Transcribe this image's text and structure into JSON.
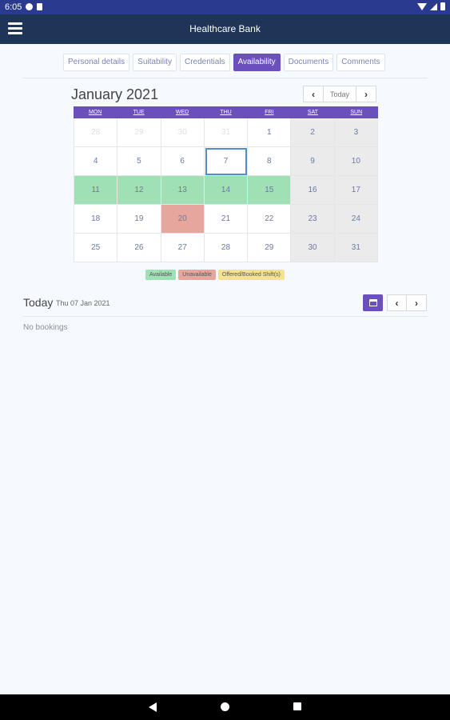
{
  "status_bar": {
    "time": "6:05"
  },
  "app_bar": {
    "title": "Healthcare Bank",
    "menu_icon": "hamburger-menu-icon"
  },
  "tabs": [
    {
      "label": "Personal details",
      "active": false
    },
    {
      "label": "Suitability",
      "active": false
    },
    {
      "label": "Credentials",
      "active": false
    },
    {
      "label": "Availability",
      "active": true
    },
    {
      "label": "Documents",
      "active": false
    },
    {
      "label": "Comments",
      "active": false
    }
  ],
  "calendar": {
    "title": "January 2021",
    "today_label": "Today",
    "weekdays": [
      "MON",
      "TUE",
      "WED",
      "THU",
      "FRI",
      "SAT",
      "SUN"
    ],
    "days": [
      {
        "d": "28",
        "other": true
      },
      {
        "d": "29",
        "other": true
      },
      {
        "d": "30",
        "other": true
      },
      {
        "d": "31",
        "other": true
      },
      {
        "d": "1"
      },
      {
        "d": "2",
        "weekend": true
      },
      {
        "d": "3",
        "weekend": true
      },
      {
        "d": "4"
      },
      {
        "d": "5"
      },
      {
        "d": "6"
      },
      {
        "d": "7",
        "today": true
      },
      {
        "d": "8"
      },
      {
        "d": "9",
        "weekend": true
      },
      {
        "d": "10",
        "weekend": true
      },
      {
        "d": "11",
        "status": "available"
      },
      {
        "d": "12",
        "status": "available"
      },
      {
        "d": "13",
        "status": "available"
      },
      {
        "d": "14",
        "status": "available"
      },
      {
        "d": "15",
        "status": "available"
      },
      {
        "d": "16",
        "weekend": true
      },
      {
        "d": "17",
        "weekend": true
      },
      {
        "d": "18"
      },
      {
        "d": "19"
      },
      {
        "d": "20",
        "status": "unavailable"
      },
      {
        "d": "21"
      },
      {
        "d": "22"
      },
      {
        "d": "23",
        "weekend": true
      },
      {
        "d": "24",
        "weekend": true
      },
      {
        "d": "25"
      },
      {
        "d": "26"
      },
      {
        "d": "27"
      },
      {
        "d": "28"
      },
      {
        "d": "29"
      },
      {
        "d": "30",
        "weekend": true
      },
      {
        "d": "31",
        "weekend": true
      }
    ]
  },
  "legend": {
    "available": "Available",
    "unavailable": "Unavailable",
    "offered": "Offered/Booked Shift(s)"
  },
  "bookings": {
    "heading": "Today",
    "date": "Thu 07 Jan 2021",
    "empty_text": "No bookings"
  },
  "colors": {
    "accent": "#6b4fbb",
    "available": "#9fe0b4",
    "unavailable": "#e7a69d",
    "offered": "#f3e28e",
    "app_bar": "#1f3557"
  }
}
